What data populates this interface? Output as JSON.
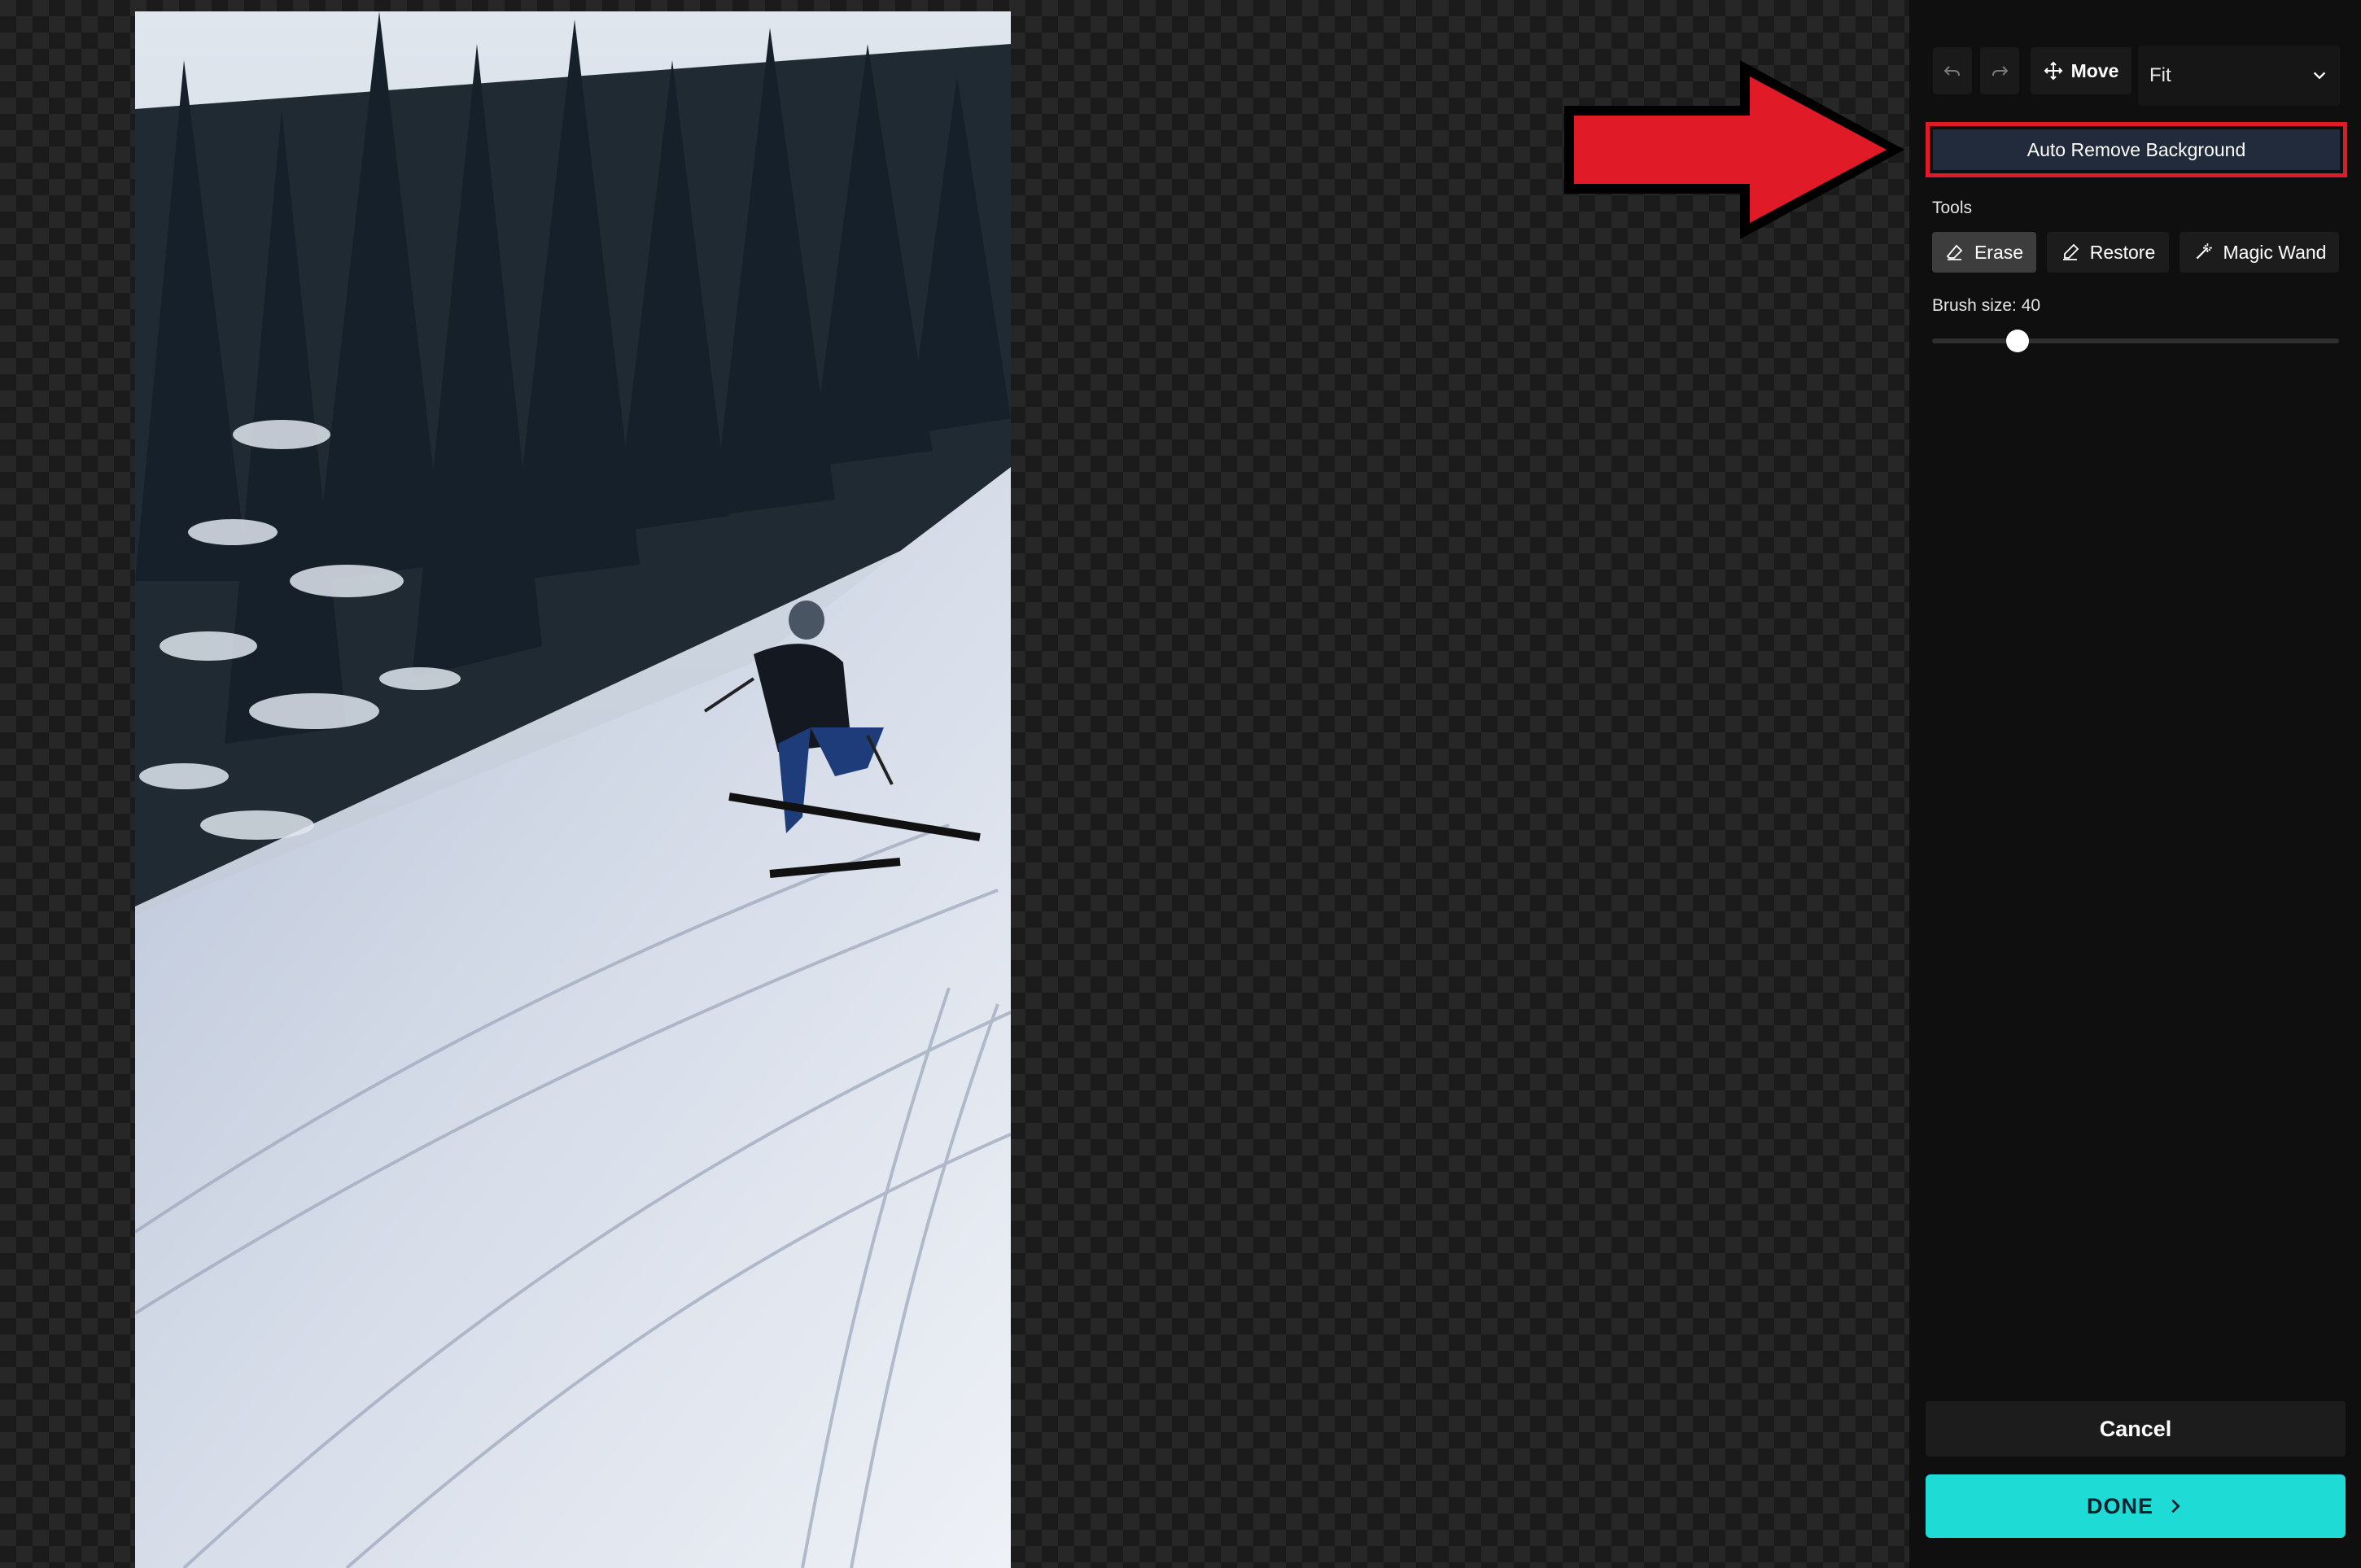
{
  "toolbar": {
    "undo_icon": "undo-icon",
    "redo_icon": "redo-icon",
    "move_label": "Move",
    "move_icon": "move-arrows-icon",
    "zoom_value": "Fit",
    "zoom_icon": "chevron-down-icon"
  },
  "auto_remove": {
    "label": "Auto Remove Background",
    "highlight_color": "#e01a26"
  },
  "tools": {
    "heading": "Tools",
    "items": [
      {
        "label": "Erase",
        "icon": "eraser-icon",
        "active": true
      },
      {
        "label": "Restore",
        "icon": "restore-brush-icon",
        "active": false
      },
      {
        "label": "Magic Wand",
        "icon": "magic-wand-icon",
        "active": false
      }
    ]
  },
  "brush": {
    "label": "Brush size: 40",
    "value": 40,
    "fraction": 0.21
  },
  "footer": {
    "cancel_label": "Cancel",
    "done_label": "DONE",
    "done_color": "#1fdbd6"
  },
  "canvas": {
    "image_subject": "skier descending snowy forest slope",
    "annotation_arrow_color": "#e01a26"
  }
}
